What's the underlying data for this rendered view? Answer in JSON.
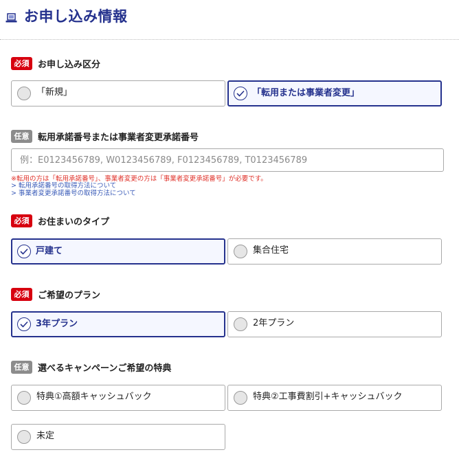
{
  "header": {
    "title": "お申し込み情報",
    "icon": "laptop-icon",
    "color": "#24318d"
  },
  "badges": {
    "required": "必須",
    "optional": "任意",
    "required_color": "#d7000f",
    "optional_color": "#8c8c8c"
  },
  "application_type": {
    "label": "お申し込み区分",
    "options": [
      {
        "label": "「新規」",
        "selected": false
      },
      {
        "label": "「転用または事業者変更」",
        "selected": true
      }
    ]
  },
  "approval_number": {
    "label": "転用承諾番号または事業者変更承諾番号",
    "placeholder": "例：E0123456789, W0123456789, F0123456789, T0123456789",
    "value": "",
    "note": "※転用の方は「転用承諾番号」、事業者変更の方は「事業者変更承諾番号」が必要です。",
    "links": [
      "> 転用承諾番号の取得方法について",
      "> 事業者変更承諾番号の取得方法について"
    ]
  },
  "residence_type": {
    "label": "お住まいのタイプ",
    "options": [
      {
        "label": "戸建て",
        "selected": true
      },
      {
        "label": "集合住宅",
        "selected": false
      }
    ]
  },
  "plan": {
    "label": "ご希望のプラン",
    "options": [
      {
        "label": "3年プラン",
        "selected": true
      },
      {
        "label": "2年プラン",
        "selected": false
      }
    ]
  },
  "campaign": {
    "label": "選べるキャンペーンご希望の特典",
    "options": [
      {
        "label": "特典①高額キャッシュバック",
        "selected": false
      },
      {
        "label": "特典②工事費割引+キャッシュバック",
        "selected": false
      },
      {
        "label": "未定",
        "selected": false
      }
    ]
  }
}
